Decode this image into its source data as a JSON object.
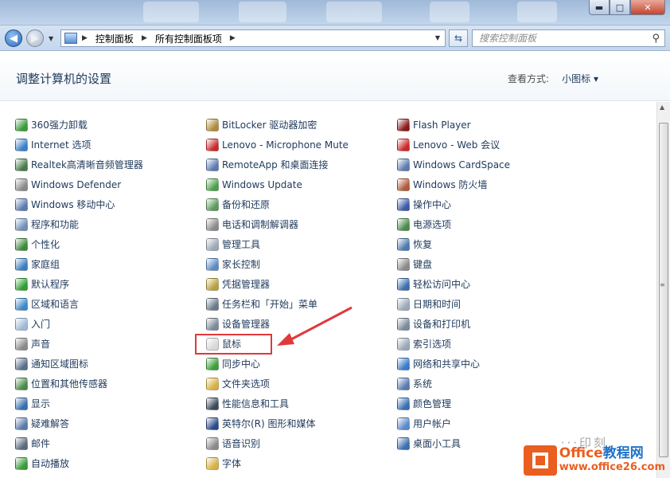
{
  "window": {
    "minimize_glyph": "▬",
    "maximize_glyph": "□",
    "close_glyph": "✕"
  },
  "nav": {
    "back_glyph": "◀",
    "forward_glyph": "▶",
    "breadcrumb": [
      "控制面板",
      "所有控制面板项"
    ],
    "search_placeholder": "搜索控制面板"
  },
  "header": {
    "title": "调整计算机的设置",
    "view_by_label": "查看方式:",
    "view_by_value": "小图标 ▾"
  },
  "columns": [
    [
      {
        "label": "360强力卸载",
        "icon": "uninstall-icon",
        "color": "#3a9a3a"
      },
      {
        "label": "Internet 选项",
        "icon": "internet-icon",
        "color": "#3b7fc8"
      },
      {
        "label": "Realtek高清晰音频管理器",
        "icon": "audio-icon",
        "color": "#4a7a4a"
      },
      {
        "label": "Windows Defender",
        "icon": "defender-icon",
        "color": "#8a8a8a"
      },
      {
        "label": "Windows 移动中心",
        "icon": "mobility-icon",
        "color": "#5a7ab0"
      },
      {
        "label": "程序和功能",
        "icon": "programs-icon",
        "color": "#6f8fb8"
      },
      {
        "label": "个性化",
        "icon": "personalize-icon",
        "color": "#3c8a3c"
      },
      {
        "label": "家庭组",
        "icon": "homegroup-icon",
        "color": "#3a7fc0"
      },
      {
        "label": "默认程序",
        "icon": "default-programs-icon",
        "color": "#2f9f2f"
      },
      {
        "label": "区域和语言",
        "icon": "region-icon",
        "color": "#3b8ac8"
      },
      {
        "label": "入门",
        "icon": "getting-started-icon",
        "color": "#9fb8d8"
      },
      {
        "label": "声音",
        "icon": "sound-icon",
        "color": "#8a8a8a"
      },
      {
        "label": "通知区域图标",
        "icon": "notification-icon",
        "color": "#5a6f8a"
      },
      {
        "label": "位置和其他传感器",
        "icon": "sensor-icon",
        "color": "#4a8a4a"
      },
      {
        "label": "显示",
        "icon": "display-icon",
        "color": "#3a6fb0"
      },
      {
        "label": "疑难解答",
        "icon": "troubleshoot-icon",
        "color": "#5a7aa8"
      },
      {
        "label": "邮件",
        "icon": "mail-icon",
        "color": "#5a6a7a"
      },
      {
        "label": "自动播放",
        "icon": "autoplay-icon",
        "color": "#3b9a3b"
      }
    ],
    [
      {
        "label": "BitLocker 驱动器加密",
        "icon": "bitlocker-icon",
        "color": "#b08a3a"
      },
      {
        "label": "Lenovo - Microphone Mute",
        "icon": "lenovo-mic-icon",
        "color": "#cc2a2a"
      },
      {
        "label": "RemoteApp 和桌面连接",
        "icon": "remoteapp-icon",
        "color": "#5a7ab0"
      },
      {
        "label": "Windows Update",
        "icon": "update-icon",
        "color": "#4aa04a"
      },
      {
        "label": "备份和还原",
        "icon": "backup-icon",
        "color": "#5a9a5a"
      },
      {
        "label": "电话和调制解调器",
        "icon": "phone-icon",
        "color": "#8a8a8a"
      },
      {
        "label": "管理工具",
        "icon": "admin-tools-icon",
        "color": "#9aa8b8"
      },
      {
        "label": "家长控制",
        "icon": "parental-icon",
        "color": "#5a8ac8"
      },
      {
        "label": "凭据管理器",
        "icon": "credential-icon",
        "color": "#b8a03a"
      },
      {
        "label": "任务栏和「开始」菜单",
        "icon": "taskbar-icon",
        "color": "#6a7a8a"
      },
      {
        "label": "设备管理器",
        "icon": "device-manager-icon",
        "color": "#7a8a9a"
      },
      {
        "label": "鼠标",
        "icon": "mouse-icon",
        "color": "#d8d8d8"
      },
      {
        "label": "同步中心",
        "icon": "sync-icon",
        "color": "#3aa03a"
      },
      {
        "label": "文件夹选项",
        "icon": "folder-options-icon",
        "color": "#d8b040"
      },
      {
        "label": "性能信息和工具",
        "icon": "performance-icon",
        "color": "#3a4a5a"
      },
      {
        "label": "英特尔(R) 图形和媒体",
        "icon": "intel-graphics-icon",
        "color": "#2a4a8a"
      },
      {
        "label": "语音识别",
        "icon": "speech-icon",
        "color": "#8a8a8a"
      },
      {
        "label": "字体",
        "icon": "fonts-icon",
        "color": "#d8b040"
      }
    ],
    [
      {
        "label": "Flash Player",
        "icon": "flash-icon",
        "color": "#8a1a1a"
      },
      {
        "label": "Lenovo - Web 会议",
        "icon": "lenovo-web-icon",
        "color": "#cc2a2a"
      },
      {
        "label": "Windows CardSpace",
        "icon": "cardspace-icon",
        "color": "#5a7ab0"
      },
      {
        "label": "Windows 防火墙",
        "icon": "firewall-icon",
        "color": "#b05a3a"
      },
      {
        "label": "操作中心",
        "icon": "action-center-icon",
        "color": "#3a5aa8"
      },
      {
        "label": "电源选项",
        "icon": "power-icon",
        "color": "#4a8a4a"
      },
      {
        "label": "恢复",
        "icon": "recovery-icon",
        "color": "#4a7ab0"
      },
      {
        "label": "键盘",
        "icon": "keyboard-icon",
        "color": "#8a8a8a"
      },
      {
        "label": "轻松访问中心",
        "icon": "ease-access-icon",
        "color": "#3a6fb0"
      },
      {
        "label": "日期和时间",
        "icon": "datetime-icon",
        "color": "#9aa8b8"
      },
      {
        "label": "设备和打印机",
        "icon": "printer-icon",
        "color": "#7a8a9a"
      },
      {
        "label": "索引选项",
        "icon": "indexing-icon",
        "color": "#9aa8b8"
      },
      {
        "label": "网络和共享中心",
        "icon": "network-icon",
        "color": "#3a7ac8"
      },
      {
        "label": "系统",
        "icon": "system-icon",
        "color": "#5a7ab0"
      },
      {
        "label": "颜色管理",
        "icon": "color-mgmt-icon",
        "color": "#3a6fb0"
      },
      {
        "label": "用户帐户",
        "icon": "user-accounts-icon",
        "color": "#5a8ac8"
      },
      {
        "label": "桌面小工具",
        "icon": "gadgets-icon",
        "color": "#3a6fb0"
      }
    ]
  ],
  "watermark": {
    "dots": "···印刻",
    "brand_left": "Office",
    "brand_right": "教程网",
    "url": "www.office26.com"
  }
}
